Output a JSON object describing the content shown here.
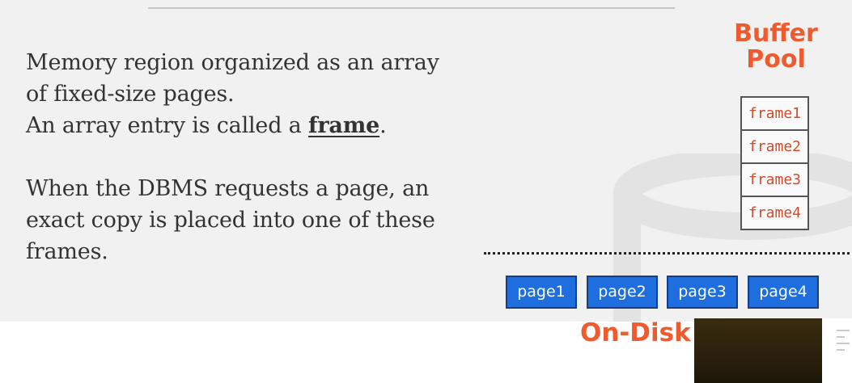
{
  "slide": {
    "text_lines": [
      "Memory region organized as an array",
      "of fixed-size pages.",
      "An array entry is called a "
    ],
    "frame_term": "frame",
    "period": ".",
    "para2_lines": [
      "When the DBMS requests a page, an",
      "exact copy is placed into one of these",
      "frames."
    ],
    "buffer_pool_title": [
      "Buffer",
      "Pool"
    ],
    "frames": [
      "frame1",
      "frame2",
      "frame3",
      "frame4"
    ],
    "pages": [
      "page1",
      "page2",
      "page3",
      "page4"
    ],
    "on_disk_title": "On-Disk"
  },
  "colors": {
    "accent_orange": "#ef5a2f",
    "page_blue": "#1e6ee0",
    "frame_text": "#d44a2a",
    "background": "#f1f1f1"
  }
}
